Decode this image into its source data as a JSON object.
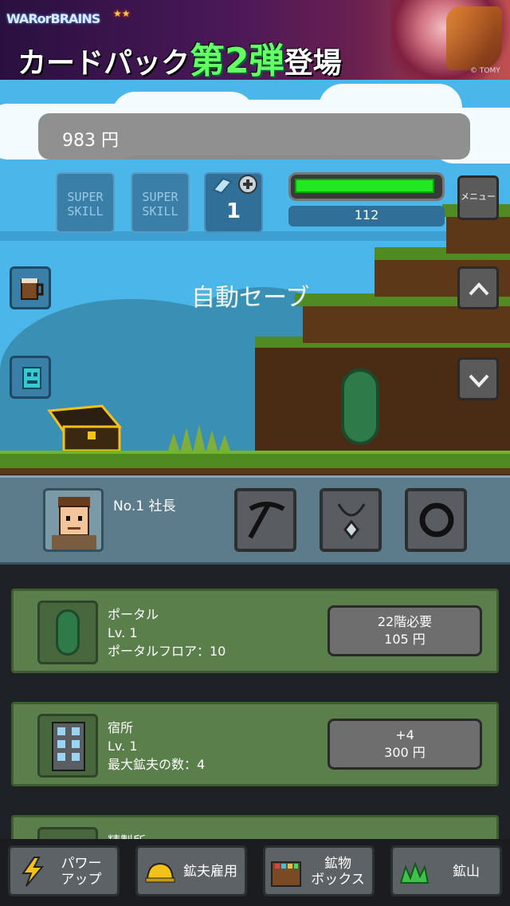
{
  "banner": {
    "logo_left": "WARorBRAINS",
    "headline_prefix": "カードパック",
    "headline_emph": "第2弾",
    "headline_suffix": "登場",
    "copyright": "© TOMY"
  },
  "hud": {
    "money": "983 円",
    "skills": [
      "SUPER\nSKILL",
      "SUPER\nSKILL"
    ],
    "gem_count": "1",
    "hp_value": "112",
    "hp_fill_fraction": 0.97,
    "menu_label": "メニュー",
    "autosave": "自動セーブ"
  },
  "worker": {
    "name": "No.1 社長"
  },
  "upgrades": [
    {
      "name": "ポータル",
      "level": "Lv. 1",
      "detail": "ポータルフロア：10",
      "btn_line1": "22階必要",
      "btn_line2": "105 円"
    },
    {
      "name": "宿所",
      "level": "Lv. 1",
      "detail": "最大鉱夫の数：4",
      "btn_line1": "+4",
      "btn_line2": "300 円"
    },
    {
      "name": "精製所"
    }
  ],
  "nav": {
    "power_up": "パワー\nアップ",
    "hire": "鉱夫雇用",
    "mineral_box": "鉱物\nボックス",
    "mine": "鉱山"
  },
  "colors": {
    "sky": "#4bb6ea",
    "card_green": "#5b7f4a",
    "hp_green": "#22e822"
  }
}
